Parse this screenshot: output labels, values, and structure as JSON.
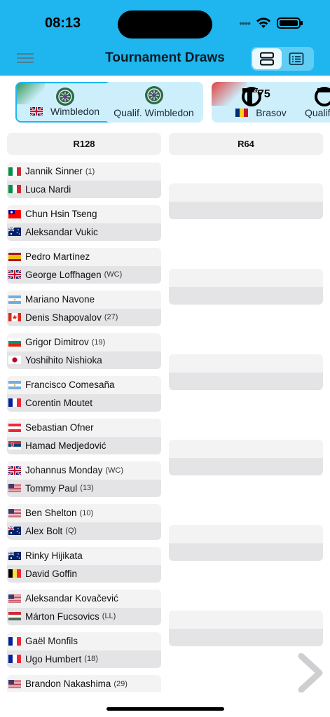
{
  "status": {
    "time": "08:13",
    "signal_dots": "••••"
  },
  "header": {
    "title": "Tournament Draws"
  },
  "tournaments": [
    {
      "label": "Wimbledon",
      "flag": "gb",
      "logo": "wimbledon-logo",
      "selected": true
    },
    {
      "label": "Qualif. Wimbledon",
      "flag": "",
      "logo": "wimbledon-logo",
      "selected": false
    },
    {
      "label": "Brasov",
      "flag": "ro",
      "logo": "atp-challenger-logo",
      "badge": "75",
      "selected": false
    },
    {
      "label": "Qualif",
      "flag": "",
      "logo": "atp-challenger-logo",
      "selected": false
    }
  ],
  "rounds": [
    {
      "label": "R128"
    },
    {
      "label": "R64"
    }
  ],
  "matches": [
    {
      "p1": {
        "name": "Jannik Sinner",
        "seed": "(1)",
        "flag": "it"
      },
      "p2": {
        "name": "Luca Nardi",
        "seed": "",
        "flag": "it"
      }
    },
    {
      "p1": {
        "name": "Chun Hsin Tseng",
        "seed": "",
        "flag": "tw"
      },
      "p2": {
        "name": "Aleksandar Vukic",
        "seed": "",
        "flag": "au"
      }
    },
    {
      "p1": {
        "name": "Pedro Martínez",
        "seed": "",
        "flag": "es"
      },
      "p2": {
        "name": "George Loffhagen",
        "seed": "(WC)",
        "flag": "gb"
      }
    },
    {
      "p1": {
        "name": "Mariano Navone",
        "seed": "",
        "flag": "ar"
      },
      "p2": {
        "name": "Denis Shapovalov",
        "seed": "(27)",
        "flag": "ca"
      }
    },
    {
      "p1": {
        "name": "Grigor Dimitrov",
        "seed": "(19)",
        "flag": "bg"
      },
      "p2": {
        "name": "Yoshihito Nishioka",
        "seed": "",
        "flag": "jp"
      }
    },
    {
      "p1": {
        "name": "Francisco Comesaña",
        "seed": "",
        "flag": "ar"
      },
      "p2": {
        "name": "Corentin Moutet",
        "seed": "",
        "flag": "fr"
      }
    },
    {
      "p1": {
        "name": "Sebastian Ofner",
        "seed": "",
        "flag": "at"
      },
      "p2": {
        "name": "Hamad Medjedović",
        "seed": "",
        "flag": "rs"
      }
    },
    {
      "p1": {
        "name": "Johannus Monday",
        "seed": "(WC)",
        "flag": "gb"
      },
      "p2": {
        "name": "Tommy Paul",
        "seed": "(13)",
        "flag": "us"
      }
    },
    {
      "p1": {
        "name": "Ben Shelton",
        "seed": "(10)",
        "flag": "us"
      },
      "p2": {
        "name": "Alex Bolt",
        "seed": "(Q)",
        "flag": "au"
      }
    },
    {
      "p1": {
        "name": "Rinky Hijikata",
        "seed": "",
        "flag": "au"
      },
      "p2": {
        "name": "David Goffin",
        "seed": "",
        "flag": "be"
      }
    },
    {
      "p1": {
        "name": "Aleksandar Kovačević",
        "seed": "",
        "flag": "us"
      },
      "p2": {
        "name": "Márton Fucsovics",
        "seed": "(LL)",
        "flag": "hu"
      }
    },
    {
      "p1": {
        "name": "Gaël Monfils",
        "seed": "",
        "flag": "fr"
      },
      "p2": {
        "name": "Ugo Humbert",
        "seed": "(18)",
        "flag": "fr"
      }
    },
    {
      "p1": {
        "name": "Brandon Nakashima",
        "seed": "(29)",
        "flag": "us"
      },
      "p2": {
        "name": "",
        "seed": "",
        "flag": ""
      }
    }
  ],
  "r64_slots": 6,
  "colors": {
    "header": "#1fb6ef",
    "chip": "#cdeffb",
    "row_top": "#f3f3f4",
    "row_bottom": "#e4e4e6"
  }
}
